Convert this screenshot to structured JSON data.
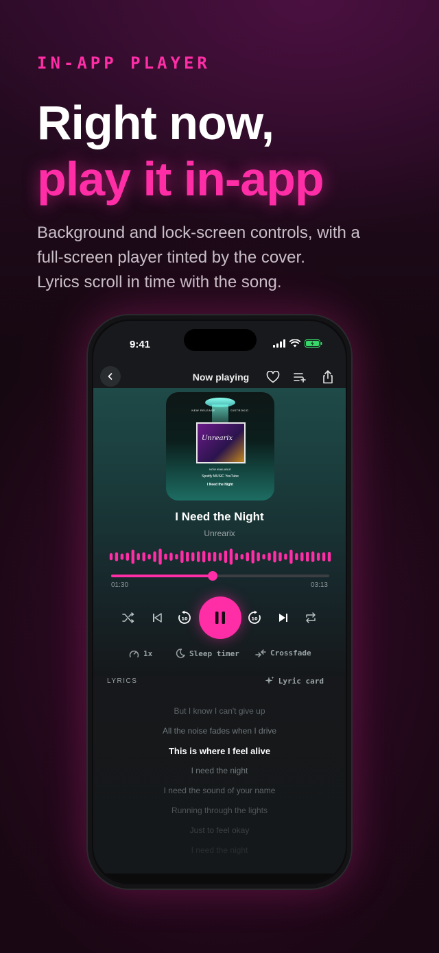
{
  "promo": {
    "eyebrow": "IN-APP PLAYER",
    "headline_line1": "Right now,",
    "headline_line2": "play it in-app",
    "subcopy": [
      "Background and lock-screen controls, with a",
      "full-screen player tinted by the cover.",
      "Lyrics scroll in time with the song."
    ],
    "accent_color": "#ff2da6"
  },
  "status_bar": {
    "time": "9:41",
    "icons": [
      "signal-icon",
      "wifi-icon",
      "battery-charging-icon"
    ]
  },
  "nav": {
    "back_icon": "chevron-left-icon",
    "title": "Now playing",
    "actions": [
      "heart-icon",
      "add-to-queue-icon",
      "share-icon"
    ]
  },
  "cover": {
    "top_left": "NEW RELEASE",
    "top_right": "DISTROKID",
    "poster_title": "Unrearix",
    "available": "NOW AVAILABLE",
    "platforms": "Spotify  MUSIC  YouTube",
    "track": "I Need the Night"
  },
  "track": {
    "title": "I Need the Night",
    "artist": "Unrearix",
    "elapsed": "01:30",
    "duration": "03:13",
    "progress": 0.466
  },
  "waveform": {
    "levels": [
      0.4,
      0.5,
      0.35,
      0.45,
      0.8,
      0.4,
      0.5,
      0.3,
      0.6,
      0.9,
      0.35,
      0.45,
      0.3,
      0.7,
      0.55,
      0.5,
      0.6,
      0.65,
      0.5,
      0.55,
      0.45,
      0.7,
      0.9,
      0.4,
      0.3,
      0.5,
      0.75,
      0.5,
      0.3,
      0.45,
      0.65,
      0.5,
      0.35,
      0.8,
      0.4,
      0.5,
      0.55,
      0.6,
      0.45,
      0.5,
      0.55
    ]
  },
  "controls": [
    "shuffle-icon",
    "skip-previous-icon",
    "rewind-10-icon",
    "pause-icon",
    "forward-10-icon",
    "skip-next-icon",
    "repeat-icon"
  ],
  "options": {
    "speed": "1x",
    "sleep": "Sleep timer",
    "crossfade": "Crossfade"
  },
  "lyrics": {
    "label": "LYRICS",
    "card_label": "Lyric card",
    "lines": [
      "But I know I can't give up",
      "All the noise fades when I drive",
      "This is where I feel alive",
      "I need the night",
      "I need the sound of your name",
      "Running through the lights",
      "Just to feel okay",
      "I need the night"
    ],
    "active_index": 2
  }
}
